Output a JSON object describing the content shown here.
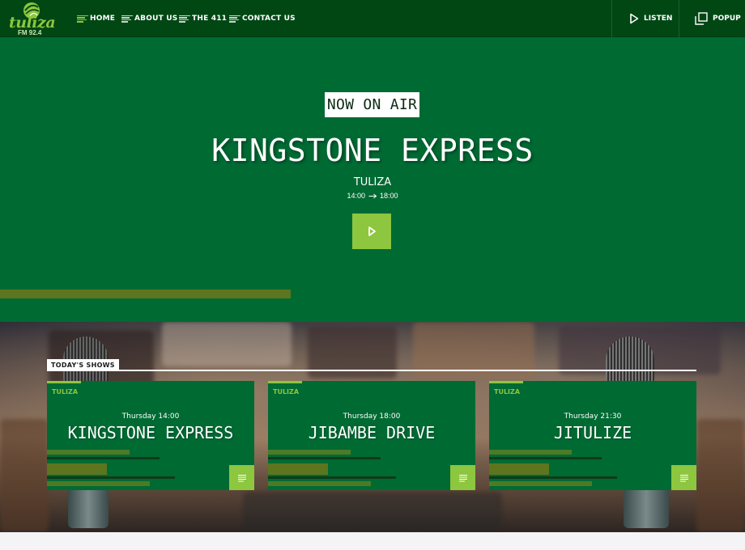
{
  "brand": {
    "logo_text": "tuliza",
    "frequency": "FM 92.4",
    "accent_color": "#8dc63f",
    "primary_color": "#006a33",
    "nav_color": "#004714"
  },
  "nav": {
    "items": [
      {
        "label": "HOME",
        "icon": "menu-lines-icon",
        "active": true
      },
      {
        "label": "ABOUT US",
        "icon": "menu-lines-icon",
        "active": false
      },
      {
        "label": "THE 411",
        "icon": "menu-lines-icon",
        "active": false
      },
      {
        "label": "CONTACT US",
        "icon": "menu-lines-icon",
        "active": false
      }
    ],
    "listen_label": "LISTEN",
    "listen_icon": "play-icon",
    "popup_label": "POPUP",
    "popup_icon": "popup-window-icon"
  },
  "hero": {
    "badge": "NOW ON AIR",
    "show_title": "KINGSTONE EXPRESS",
    "host": "TULIZA",
    "time_start": "14:00",
    "time_end": "18:00",
    "play_icon": "play-icon",
    "progress_fraction": 0.39
  },
  "today": {
    "label": "TODAY'S SHOWS",
    "shows": [
      {
        "tag": "TULIZA",
        "time": "Thursday 14:00",
        "title": "KINGSTONE EXPRESS",
        "icon": "lines-icon"
      },
      {
        "tag": "TULIZA",
        "time": "Thursday 18:00",
        "title": "JIBAMBE DRIVE",
        "icon": "lines-icon"
      },
      {
        "tag": "TULIZA",
        "time": "Thursday 21:30",
        "title": "JITULIZE",
        "icon": "lines-icon"
      }
    ]
  }
}
